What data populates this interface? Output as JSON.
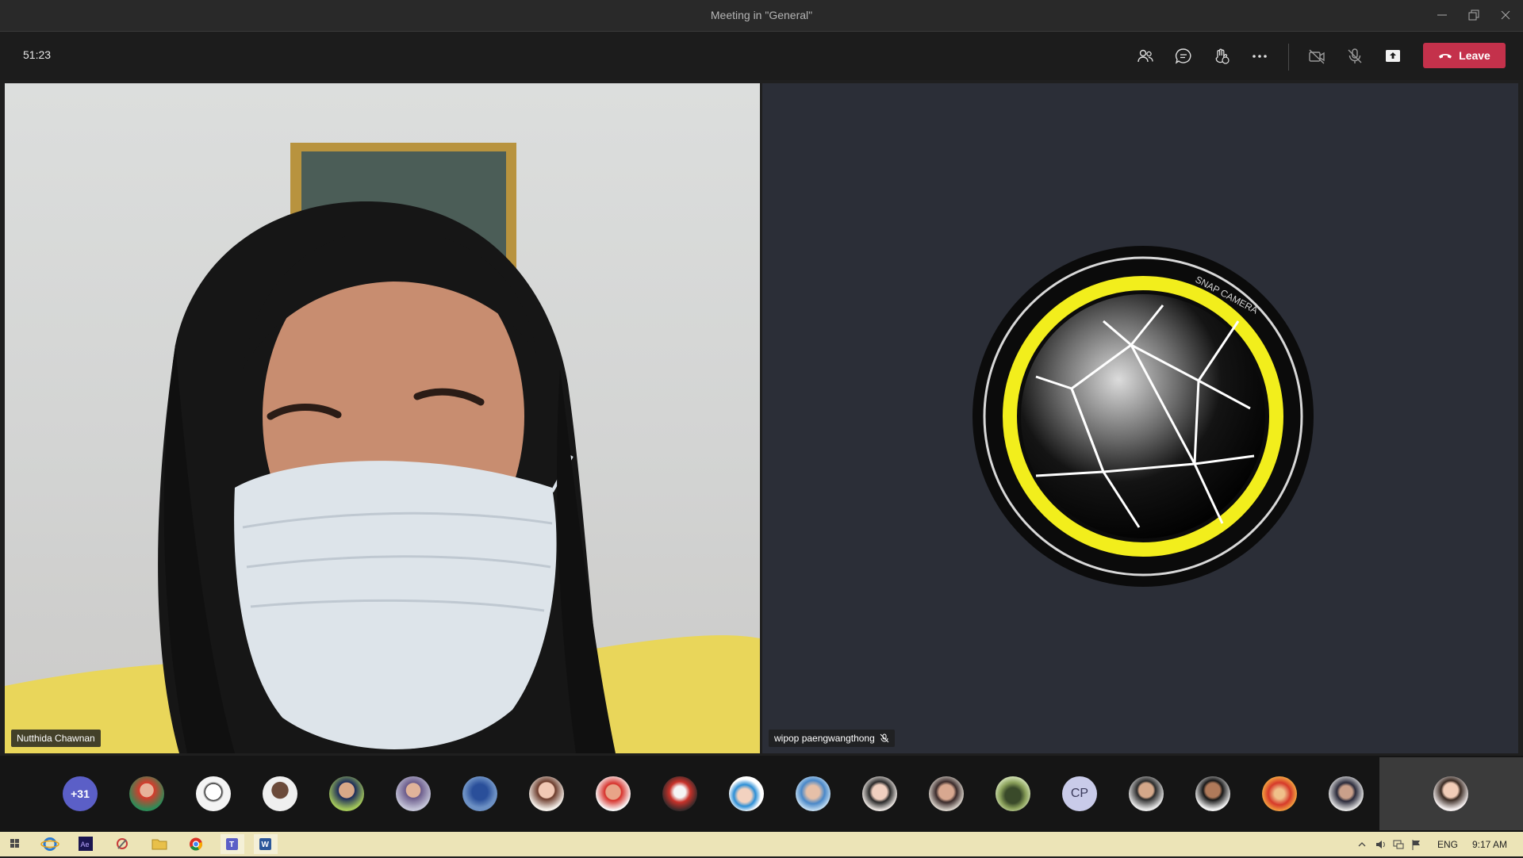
{
  "window": {
    "title": "Meeting in \"General\""
  },
  "toolbar": {
    "timer": "51:23",
    "leave_label": "Leave",
    "accent": "#c4314b"
  },
  "tiles": [
    {
      "name": "Nutthida Chawnan"
    },
    {
      "name": "wipop paengwangthong",
      "muted": true,
      "logo_text": "SNAP CAMERA"
    }
  ],
  "participants": {
    "overflow": "+31",
    "initials": "CP"
  },
  "taskbar": {
    "language": "ENG",
    "clock": "9:17 AM"
  }
}
